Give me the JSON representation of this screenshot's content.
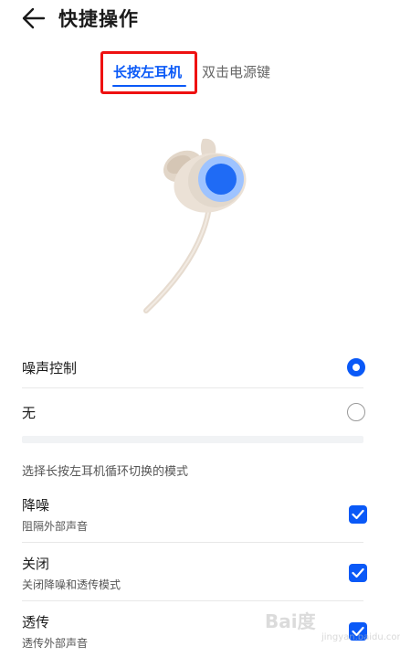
{
  "header": {
    "title": "快捷操作"
  },
  "tabs": [
    {
      "label": "长按左耳机",
      "active": true
    },
    {
      "label": "双击电源键",
      "active": false
    }
  ],
  "options": [
    {
      "label": "噪声控制",
      "selected": true
    },
    {
      "label": "无",
      "selected": false
    }
  ],
  "caption": "选择长按左耳机循环切换的模式",
  "modes": [
    {
      "title": "降噪",
      "subtitle": "阻隔外部声音",
      "checked": true
    },
    {
      "title": "关闭",
      "subtitle": "关闭降噪和透传模式",
      "checked": true
    },
    {
      "title": "透传",
      "subtitle": "透传外部声音",
      "checked": true
    }
  ],
  "colors": {
    "accent": "#0a59f7",
    "highlight": "#ee1111",
    "earbud": "#e9ddd0"
  },
  "watermark": {
    "logo": "Bai度",
    "sub": "jingyan.baidu.com"
  }
}
